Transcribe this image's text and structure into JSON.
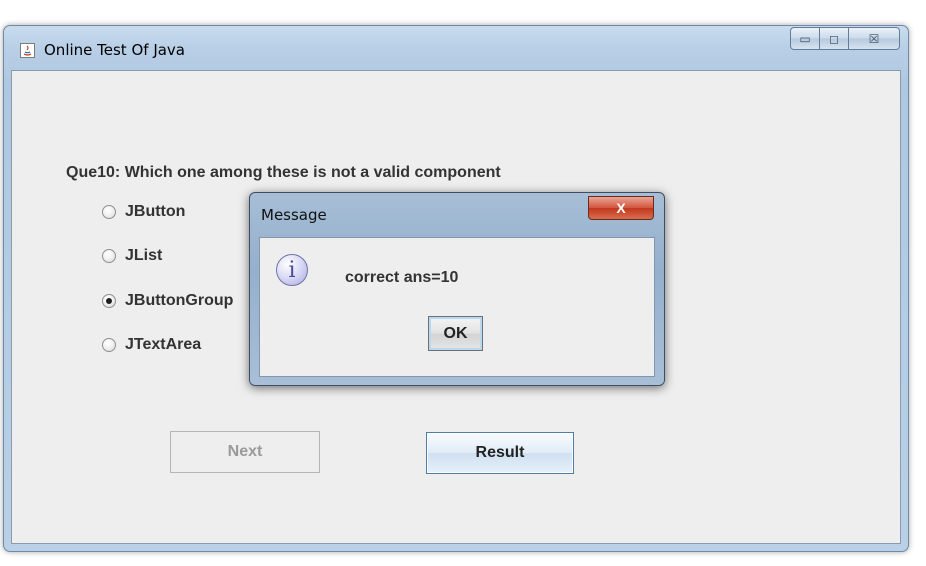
{
  "window": {
    "title": "Online Test Of Java",
    "controls": {
      "minimize": "▭",
      "maximize": "◻",
      "close": "☒"
    }
  },
  "quiz": {
    "question": "Que10: Which one among these is not a valid component",
    "options": [
      {
        "label": "JButton",
        "selected": false
      },
      {
        "label": "JList",
        "selected": false
      },
      {
        "label": "JButtonGroup",
        "selected": true
      },
      {
        "label": "JTextArea",
        "selected": false
      }
    ],
    "next_label": "Next",
    "next_enabled": false,
    "result_label": "Result"
  },
  "dialog": {
    "title": "Message",
    "close_glyph": "X",
    "icon": "info-icon",
    "icon_glyph": "i",
    "message": "correct ans=10",
    "ok_label": "OK"
  }
}
